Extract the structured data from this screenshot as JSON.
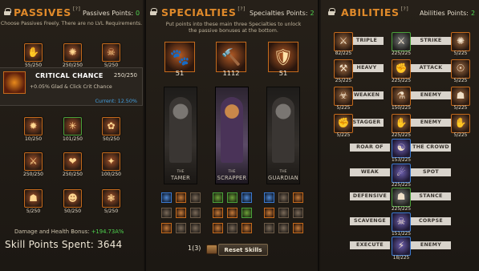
{
  "passives": {
    "title": "PASSIVES",
    "q": "[?]",
    "points_label": "Passives Points:",
    "points_value": "0",
    "subtitle": "Choose Passives Freely. There are no LVL Requirements.",
    "top_icons": [
      {
        "count": "55/250",
        "glyph": "✋",
        "border": "orange"
      },
      {
        "count": "250/250",
        "glyph": "✺",
        "border": "orange"
      },
      {
        "count": "5/250",
        "glyph": "☠",
        "border": "orange"
      }
    ],
    "tooltip": {
      "name": "CRITICAL CHANCE",
      "count": "250/250",
      "description": "+0.05% Glad & Click Crit Chance",
      "current": "Current: 12.50%"
    },
    "grid_icons": [
      {
        "count": "10/250",
        "glyph": "✹",
        "border": "orange"
      },
      {
        "count": "101/250",
        "glyph": "✳",
        "border": "green"
      },
      {
        "count": "50/250",
        "glyph": "✿",
        "border": "orange"
      },
      {
        "count": "250/250",
        "glyph": "⚔",
        "border": "orange"
      },
      {
        "count": "250/250",
        "glyph": "❤",
        "border": "orange"
      },
      {
        "count": "100/250",
        "glyph": "✦",
        "border": "orange"
      },
      {
        "count": "5/250",
        "glyph": "☗",
        "border": "orange"
      },
      {
        "count": "50/250",
        "glyph": "☻",
        "border": "orange"
      },
      {
        "count": "5/250",
        "glyph": "❃",
        "border": "orange"
      }
    ],
    "damage_label": "Damage and Health Bonus:",
    "damage_value": "+194.73A%",
    "spent_label": "Skill Points Spent:",
    "spent_value": "3644"
  },
  "specialties": {
    "title": "SPECIALTIES",
    "q": "[?]",
    "points_label": "Specialties Points:",
    "points_value": "2",
    "subtitle": "Put points into these main three Specialties to unlock the passive bonuses at the bottom.",
    "big": [
      {
        "value": "51",
        "glyph": "🐾"
      },
      {
        "value": "1112",
        "glyph": "🔨"
      },
      {
        "value": "51",
        "glyph": "🛡"
      }
    ],
    "chars": [
      {
        "the": "THE",
        "name": "TAMER"
      },
      {
        "the": "THE",
        "name": "SCRAPPER"
      },
      {
        "the": "THE",
        "name": "GUARDIAN"
      }
    ],
    "footer_count": "1(3)",
    "reset_label": "Reset Skills"
  },
  "abilities": {
    "title": "ABILITIES",
    "q": "[?]",
    "points_label": "Abilities Points:",
    "points_value": "2",
    "rows": [
      {
        "label": "TRIPLE",
        "label2": "STRIKE"
      },
      {
        "label": "HEAVY",
        "label2": "ATTACK"
      },
      {
        "label": "WEAKEN",
        "label2": "ENEMY"
      },
      {
        "label": "STAGGER",
        "label2": "ENEMY"
      },
      {
        "label": "ROAR OF",
        "label2": "THE CROWD"
      },
      {
        "label": "WEAK",
        "label2": "SPOT"
      },
      {
        "label": "DEFENSIVE",
        "label2": "STANCE"
      },
      {
        "label": "SCAVENGE",
        "label2": "CORPSE"
      },
      {
        "label": "EXECUTE",
        "label2": "ENEMY"
      }
    ],
    "left_icons": [
      {
        "count": "82/225",
        "glyph": "⚔",
        "style": "o"
      },
      {
        "count": "25/225",
        "glyph": "⚒",
        "style": "o"
      },
      {
        "count": "5/225",
        "glyph": "☣",
        "style": "o"
      },
      {
        "count": "5/225",
        "glyph": "✊",
        "style": "o"
      }
    ],
    "mid_icons": [
      {
        "count": "225/225",
        "glyph": "⚔",
        "style": "g"
      },
      {
        "count": "225/225",
        "glyph": "✊",
        "style": "o"
      },
      {
        "count": "150/225",
        "glyph": "⚗",
        "style": "o"
      },
      {
        "count": "225/225",
        "glyph": "✋",
        "style": "o"
      },
      {
        "count": "153/225",
        "glyph": "☯",
        "style": "b"
      },
      {
        "count": "225/225",
        "glyph": "☄",
        "style": "b"
      },
      {
        "count": "225/225",
        "glyph": "☗",
        "style": "g"
      },
      {
        "count": "151/225",
        "glyph": "☠",
        "style": "b"
      },
      {
        "count": "18/225",
        "glyph": "⚡",
        "style": "b"
      }
    ],
    "right_icons": [
      {
        "count": "5/225",
        "glyph": "✺",
        "style": "o"
      },
      {
        "count": "5/225",
        "glyph": "☉",
        "style": "o"
      },
      {
        "count": "5/225",
        "glyph": "☗",
        "style": "o"
      },
      {
        "count": "5/225",
        "glyph": "✋",
        "style": "o"
      }
    ]
  }
}
